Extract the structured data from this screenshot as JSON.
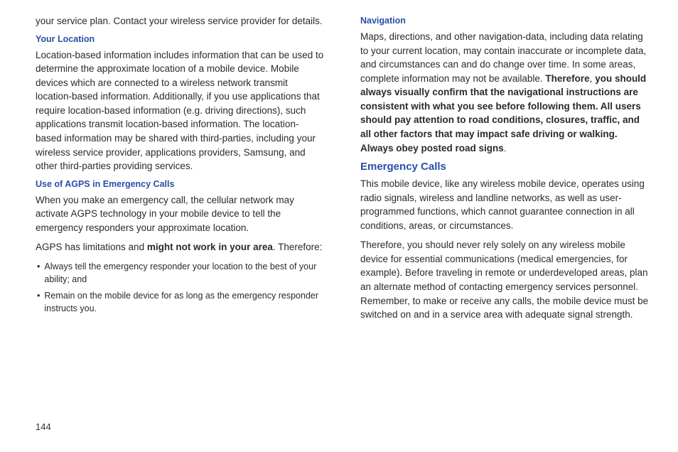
{
  "pageNumber": "144",
  "leftColumn": {
    "introTail": "your service plan. Contact your wireless service provider for details.",
    "yourLocation": {
      "heading": "Your Location",
      "body": "Location-based information includes information that can be used to determine the approximate location of a mobile device. Mobile devices which are connected to a wireless network transmit location-based information. Additionally, if you use applications that require location-based information (e.g. driving directions), such applications transmit location-based information. The location-based information may be shared with third-parties, including your wireless service provider, applications providers, Samsung, and other third-parties providing services."
    },
    "agps": {
      "heading": "Use of AGPS in Emergency Calls",
      "p1": "When you make an emergency call, the cellular network may activate AGPS technology in your mobile device to tell the emergency responders your approximate location.",
      "p2_pre": "AGPS has limitations and ",
      "p2_bold": "might not work in your area",
      "p2_post": ". Therefore:",
      "bullets": [
        "Always tell the emergency responder your location to the best of your ability; and",
        "Remain on the mobile device for as long as the emergency responder instructs you."
      ]
    }
  },
  "rightColumn": {
    "navigation": {
      "heading": "Navigation",
      "p1": "Maps, directions, and other navigation-data, including data relating to your current location, may contain inaccurate or incomplete data, and circumstances can and do change over time. In some areas, complete information may not be available. ",
      "boldPre": "Therefore",
      "boldSep": ", ",
      "boldRest": "you should always visually confirm that the navigational instructions are consistent with what you see before following them. All users should pay attention to road conditions, closures, traffic, and all other factors that may impact safe driving or walking. Always obey posted road signs",
      "boldEnd": "."
    },
    "emergencyCalls": {
      "heading": "Emergency Calls",
      "p1": "This mobile device, like any wireless mobile device, operates using radio signals, wireless and landline networks, as well as user-programmed functions, which cannot guarantee connection in all conditions, areas, or circumstances.",
      "p2": "Therefore, you should never rely solely on any wireless mobile device for essential communications (medical emergencies, for example). Before traveling in remote or underdeveloped areas, plan an alternate method of contacting emergency services personnel. Remember, to make or receive any calls, the mobile device must be switched on and in a service area with adequate signal strength."
    }
  }
}
